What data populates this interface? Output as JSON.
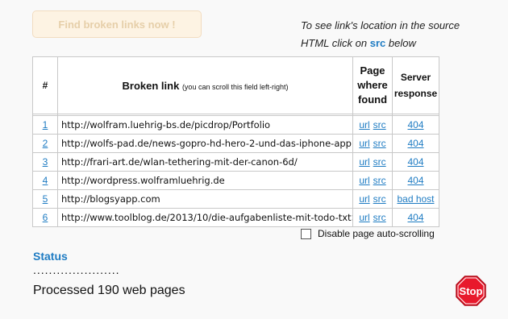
{
  "find_button": "Find broken links now !",
  "hint": {
    "line1": "To see link's location in the source",
    "line2_pre": "HTML click on",
    "src": "src",
    "line2_post": "below"
  },
  "table": {
    "headers": {
      "num": "#",
      "link": "Broken link",
      "link_note": "(you can scroll this field left-right)",
      "page1": "Page",
      "page2": "where",
      "page3": "found",
      "server1": "Server",
      "server2": "response"
    },
    "rows": [
      {
        "num": "1",
        "url": "http://wolfram.luehrig-bs.de/picdrop/Portfolio",
        "url_label": "url",
        "src_label": "src",
        "response": "404"
      },
      {
        "num": "2",
        "url": "http://wolfs-pad.de/news-gopro-hd-hero-2-und-das-iphone-app>>",
        "url_label": "url",
        "src_label": "src",
        "response": "404"
      },
      {
        "num": "3",
        "url": "http://frari-art.de/wlan-tethering-mit-der-canon-6d/",
        "url_label": "url",
        "src_label": "src",
        "response": "404"
      },
      {
        "num": "4",
        "url": "http://wordpress.wolframluehrig.de",
        "url_label": "url",
        "src_label": "src",
        "response": "404"
      },
      {
        "num": "5",
        "url": "http://blogsyapp.com",
        "url_label": "url",
        "src_label": "src",
        "response": "bad host"
      },
      {
        "num": "6",
        "url": "http://www.toolblog.de/2013/10/die-aufgabenliste-mit-todo-txt>>",
        "url_label": "url",
        "src_label": "src",
        "response": "404"
      }
    ]
  },
  "auto_scroll_label": "Disable page auto-scrolling",
  "status": {
    "title": "Status",
    "dots": "......................",
    "processed": "Processed 190 web pages"
  },
  "stop_label": "Stop",
  "colors": {
    "link": "#1f7cc3",
    "stop": "#e8192c"
  }
}
